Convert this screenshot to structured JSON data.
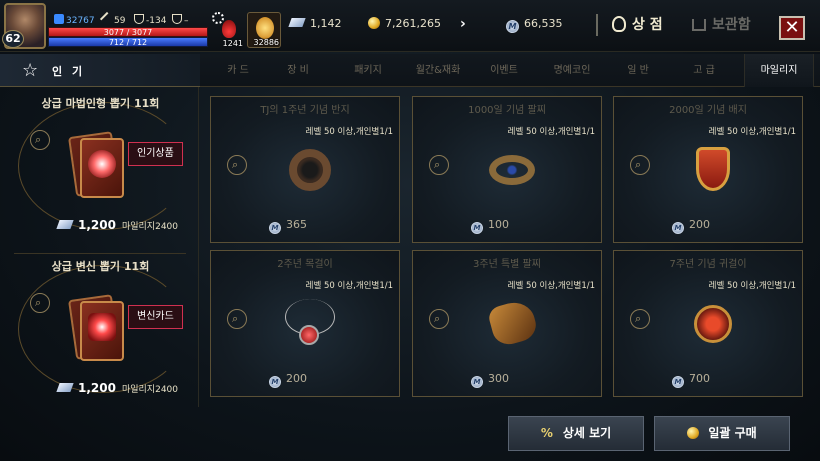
{
  "player": {
    "level": "62",
    "power": "32767",
    "attack": "59",
    "defense": "-134",
    "rank": "–",
    "hp": "3077 / 3077",
    "mp": "712 / 712"
  },
  "inventory": {
    "potion_count": "1241",
    "buff_count": "32886"
  },
  "currency": {
    "crystals": "1,142",
    "gold": "7,261,265",
    "mileage": "66,535"
  },
  "header": {
    "shop_label": "상 점",
    "storage_label": "보관함",
    "close": "✕"
  },
  "tabs": {
    "popular": "인 기",
    "items": [
      "카 드",
      "장 비",
      "패키지",
      "월간&재화",
      "이벤트",
      "명예코인",
      "일 반",
      "고 급",
      "마일리지"
    ],
    "active": "마일리지"
  },
  "featured": [
    {
      "title": "상급 마법인형 뽑기 11회",
      "badge": "인기상품",
      "price": "1,200",
      "unit": "마일리지2400"
    },
    {
      "title": "상급 변신 뽑기 11회",
      "badge": "변신카드",
      "price": "1,200",
      "unit": "마일리지2400"
    }
  ],
  "items": [
    {
      "name": "TJ의 1주년 기념 반지",
      "req": "레벨 50 이상,개인별1/1",
      "cost": "365",
      "icon": "ring-icon"
    },
    {
      "name": "1000일 기념 팔찌",
      "req": "레벨 50 이상,개인별1/1",
      "cost": "100",
      "icon": "bracelet-icon"
    },
    {
      "name": "2000일 기념 배지",
      "req": "레벨 50 이상,개인별1/1",
      "cost": "200",
      "icon": "badge-icon"
    },
    {
      "name": "2주년 목걸이",
      "req": "레벨 50 이상,개인별1/1",
      "cost": "200",
      "icon": "necklace-icon"
    },
    {
      "name": "3주년 특별 팔찌",
      "req": "레벨 50 이상,개인별1/1",
      "cost": "300",
      "icon": "gauntlet-icon"
    },
    {
      "name": "7주년 기념 귀걸이",
      "req": "레벨 50 이상,개인별1/1",
      "cost": "700",
      "icon": "earring-icon"
    }
  ],
  "footer": {
    "details_label": "상세 보기",
    "bulk_buy_label": "일괄 구매"
  },
  "colors": {
    "accent": "#d03050",
    "gold": "#e0a822",
    "close_bg": "#7a1010"
  }
}
